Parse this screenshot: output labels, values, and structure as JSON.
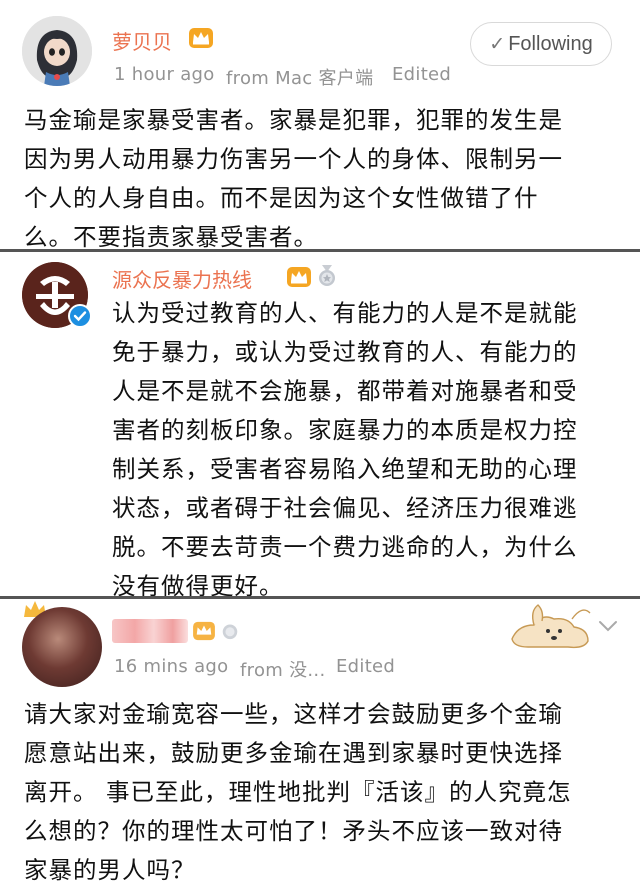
{
  "posts": [
    {
      "username": "萝贝贝",
      "time": "1 hour ago",
      "source": "from Mac 客户端",
      "edited": "Edited",
      "follow_label": "Following",
      "text_lines": [
        "马金瑜是家暴受害者。家暴是犯罪，犯罪的发生是",
        "因为男人动用暴力伤害另一个人的身体、限制另一",
        "个人的人身自由。而不是因为这个女性做错了什",
        "么。不要指责家暴受害者。"
      ]
    },
    {
      "username": "源众反暴力热线",
      "logo_text": "e",
      "text_lines": [
        "认为受过教育的人、有能力的人是不是就能",
        "免于暴力，或认为受过教育的人、有能力的",
        "人是不是就不会施暴，都带着对施暴者和受",
        "害者的刻板印象。家庭暴力的本质是权力控",
        "制关系，受害者容易陷入绝望和无助的心理",
        "状态，或者碍于社会偏见、经济压力很难逃",
        "脱。不要去苛责一个费力逃命的人，为什么",
        "没有做得更好。"
      ]
    },
    {
      "time": "16 mins ago",
      "source": "from 没...",
      "edited": "Edited",
      "text_lines": [
        "请大家对金瑜宽容一些，这样才会鼓励更多个金瑜",
        "愿意站出来，鼓励更多金瑜在遇到家暴时更快选择",
        "离开。 事已至此，理性地批判『活该』的人究竟怎",
        "么想的？你的理性太可怕了！矛头不应该一致对待",
        "家暴的男人吗？"
      ]
    }
  ],
  "icons": {
    "crown": "crown-icon",
    "verified": "verified-icon",
    "medal": "medal-icon",
    "check": "check-icon",
    "chevron": "chevron-down-icon",
    "decoration": "dog-sticker"
  },
  "colors": {
    "username": "#eb7350",
    "meta": "#939393",
    "verified": "#1d8fe1",
    "crown": "#f5a623"
  }
}
